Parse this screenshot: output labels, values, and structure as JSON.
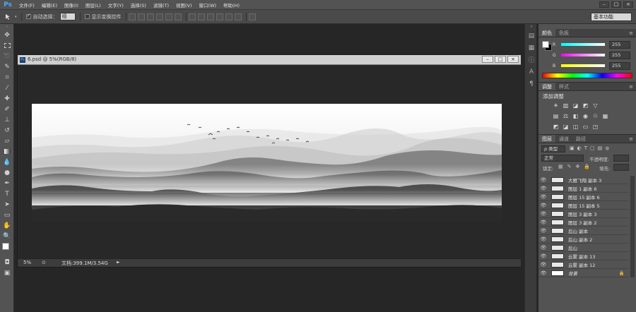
{
  "app": {
    "logo": "Ps"
  },
  "menu": [
    "文件(F)",
    "编辑(E)",
    "图像(I)",
    "图层(L)",
    "文字(Y)",
    "选择(S)",
    "滤镜(T)",
    "视图(V)",
    "窗口(W)",
    "帮助(H)"
  ],
  "window_controls": [
    "–",
    "□",
    "×"
  ],
  "options": {
    "tool_icon": "move-tool",
    "auto_select_label": "自动选择：",
    "auto_select_checked": true,
    "auto_select_value": "组",
    "show_transform_label": "显示变换控件",
    "workspace": "基本功能"
  },
  "document": {
    "title": "6.psd @ 5%(RGB/8)",
    "zoom": "5%",
    "info": "文档:399.1M/3.54G",
    "status_arrow": "►"
  },
  "color_panel": {
    "tabs": [
      "颜色",
      "色板"
    ],
    "channels": [
      {
        "label": "R",
        "value": "255"
      },
      {
        "label": "G",
        "value": "255"
      },
      {
        "label": "B",
        "value": "255"
      }
    ]
  },
  "adjust_panel": {
    "tabs": [
      "调整",
      "样式"
    ],
    "heading": "添加调整"
  },
  "layers_panel": {
    "tabs": [
      "图层",
      "通道",
      "路径"
    ],
    "filter_label": "ρ 类型",
    "blend_mode": "正常",
    "opacity_label": "不透明度:",
    "lock_label": "锁定:",
    "fill_label": "填充:",
    "layers": [
      {
        "name": "大雁飞翔 副本 3"
      },
      {
        "name": "图层 1 副本 6"
      },
      {
        "name": "图层 15 副本 6"
      },
      {
        "name": "图层 15 副本 5"
      },
      {
        "name": "图层 3 副本 3"
      },
      {
        "name": "图层 3 副本 2"
      },
      {
        "name": "后山 副本"
      },
      {
        "name": "后山 副本 2"
      },
      {
        "name": "后山"
      },
      {
        "name": "云雾 副本 13"
      },
      {
        "name": "云雾 副本 12"
      },
      {
        "name": "背景"
      }
    ]
  }
}
